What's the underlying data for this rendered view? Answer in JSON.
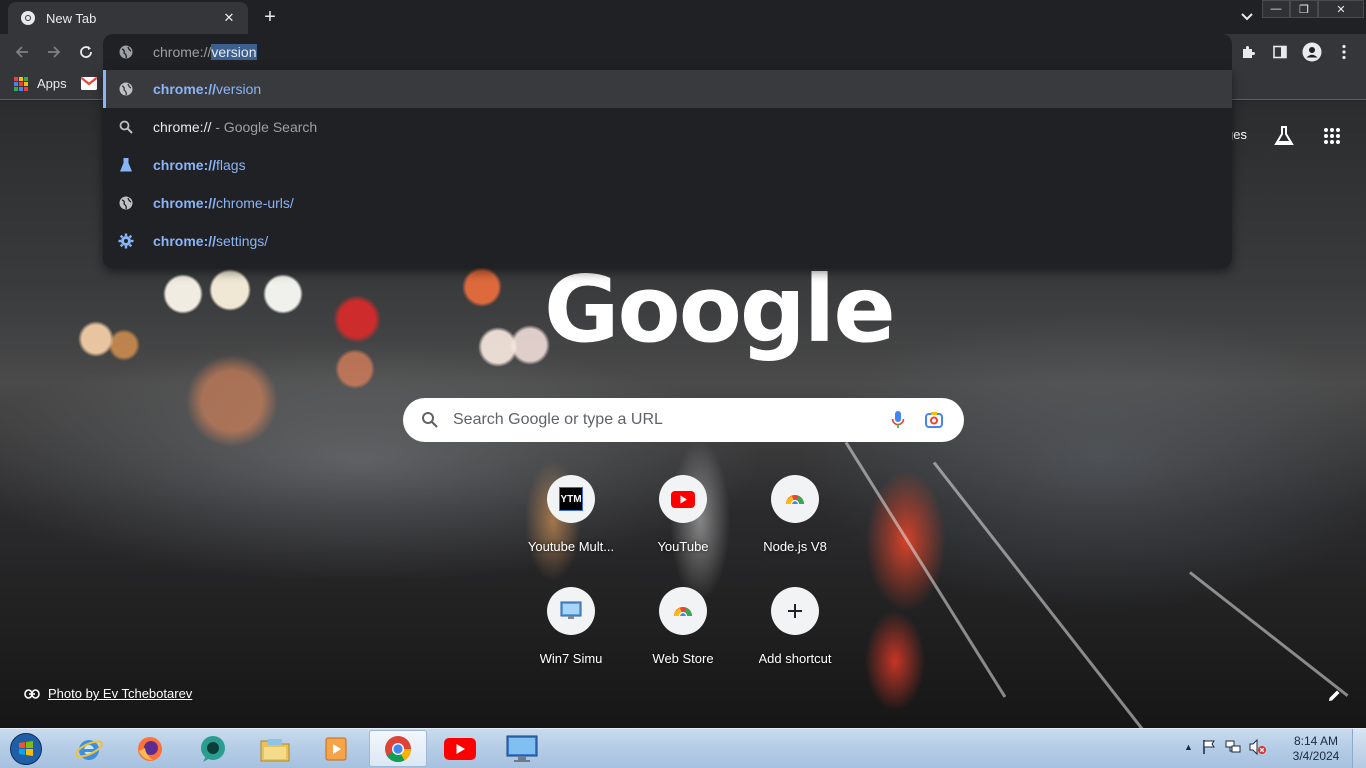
{
  "browser": {
    "tab": {
      "title": "New Tab"
    },
    "omnibox": {
      "typed": "chrome://",
      "autocomplete": "version"
    },
    "bookmarks": {
      "apps_label": "Apps"
    },
    "colors": {
      "accent": "#8ab4f8",
      "dark_bg": "#202124",
      "toolbar_bg": "#35363a"
    }
  },
  "dropdown": {
    "items": [
      {
        "bold": "chrome://",
        "rest": "version",
        "icon": "globe-icon"
      },
      {
        "main": "chrome://",
        "sub": "- Google Search",
        "icon": "search-icon"
      },
      {
        "bold": "chrome://",
        "rest": "flags",
        "icon": "flask-icon"
      },
      {
        "bold": "chrome://",
        "rest": "chrome-urls/",
        "icon": "globe-icon"
      },
      {
        "bold": "chrome://",
        "rest": "settings/",
        "icon": "gear-icon"
      }
    ]
  },
  "ntp": {
    "header_link": "ges",
    "logo": "Google",
    "search_placeholder": "Search Google or type a URL",
    "shortcuts": [
      {
        "label": "Youtube Mult...",
        "icon": "ytm-icon"
      },
      {
        "label": "YouTube",
        "icon": "youtube-icon"
      },
      {
        "label": "Node.js V8",
        "icon": "chrome-webstore-icon"
      },
      {
        "label": "Win7 Simu",
        "icon": "win7-icon"
      },
      {
        "label": "Web Store",
        "icon": "chrome-webstore-icon"
      },
      {
        "label": "Add shortcut",
        "icon": "plus-icon"
      }
    ],
    "attribution": "Photo by Ev Tchebotarev"
  },
  "taskbar": {
    "time": "8:14 AM",
    "date": "3/4/2024"
  }
}
